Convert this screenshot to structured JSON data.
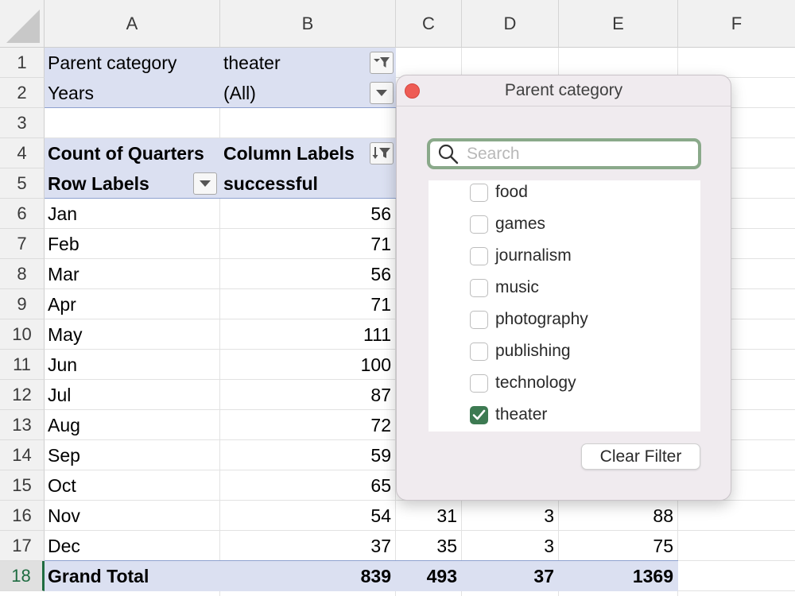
{
  "columns": [
    "A",
    "B",
    "C",
    "D",
    "E",
    "F"
  ],
  "rows": [
    "1",
    "2",
    "3",
    "4",
    "5",
    "6",
    "7",
    "8",
    "9",
    "10",
    "11",
    "12",
    "13",
    "14",
    "15",
    "16",
    "17",
    "18"
  ],
  "filters": {
    "parent_label": "Parent category",
    "parent_value": "theater",
    "years_label": "Years",
    "years_value": "(All)"
  },
  "pivot": {
    "values_label": "Count of Quarters",
    "column_labels": "Column Labels",
    "row_labels": "Row Labels",
    "series_header": "successful",
    "months": [
      {
        "label": "Jan",
        "b": "56"
      },
      {
        "label": "Feb",
        "b": "71"
      },
      {
        "label": "Mar",
        "b": "56"
      },
      {
        "label": "Apr",
        "b": "71"
      },
      {
        "label": "May",
        "b": "111"
      },
      {
        "label": "Jun",
        "b": "100"
      },
      {
        "label": "Jul",
        "b": "87"
      },
      {
        "label": "Aug",
        "b": "72"
      },
      {
        "label": "Sep",
        "b": "59"
      },
      {
        "label": "Oct",
        "b": "65"
      },
      {
        "label": "Nov",
        "b": "54",
        "c": "31",
        "d": "3",
        "e": "88"
      },
      {
        "label": "Dec",
        "b": "37",
        "c": "35",
        "d": "3",
        "e": "75"
      }
    ],
    "grand_total": {
      "label": "Grand Total",
      "b": "839",
      "c": "493",
      "d": "37",
      "e": "1369"
    }
  },
  "popup": {
    "title": "Parent category",
    "search_placeholder": "Search",
    "items": [
      {
        "label": "food",
        "checked": false
      },
      {
        "label": "games",
        "checked": false
      },
      {
        "label": "journalism",
        "checked": false
      },
      {
        "label": "music",
        "checked": false
      },
      {
        "label": "photography",
        "checked": false
      },
      {
        "label": "publishing",
        "checked": false
      },
      {
        "label": "technology",
        "checked": false
      },
      {
        "label": "theater",
        "checked": true
      }
    ],
    "clear_label": "Clear Filter"
  },
  "colors": {
    "pivot_band": "#dbe0f1",
    "active_row": "#1e6c41",
    "checkbox_checked": "#3d7a52",
    "close_button": "#ee5c55",
    "search_border": "#8aa98a"
  }
}
